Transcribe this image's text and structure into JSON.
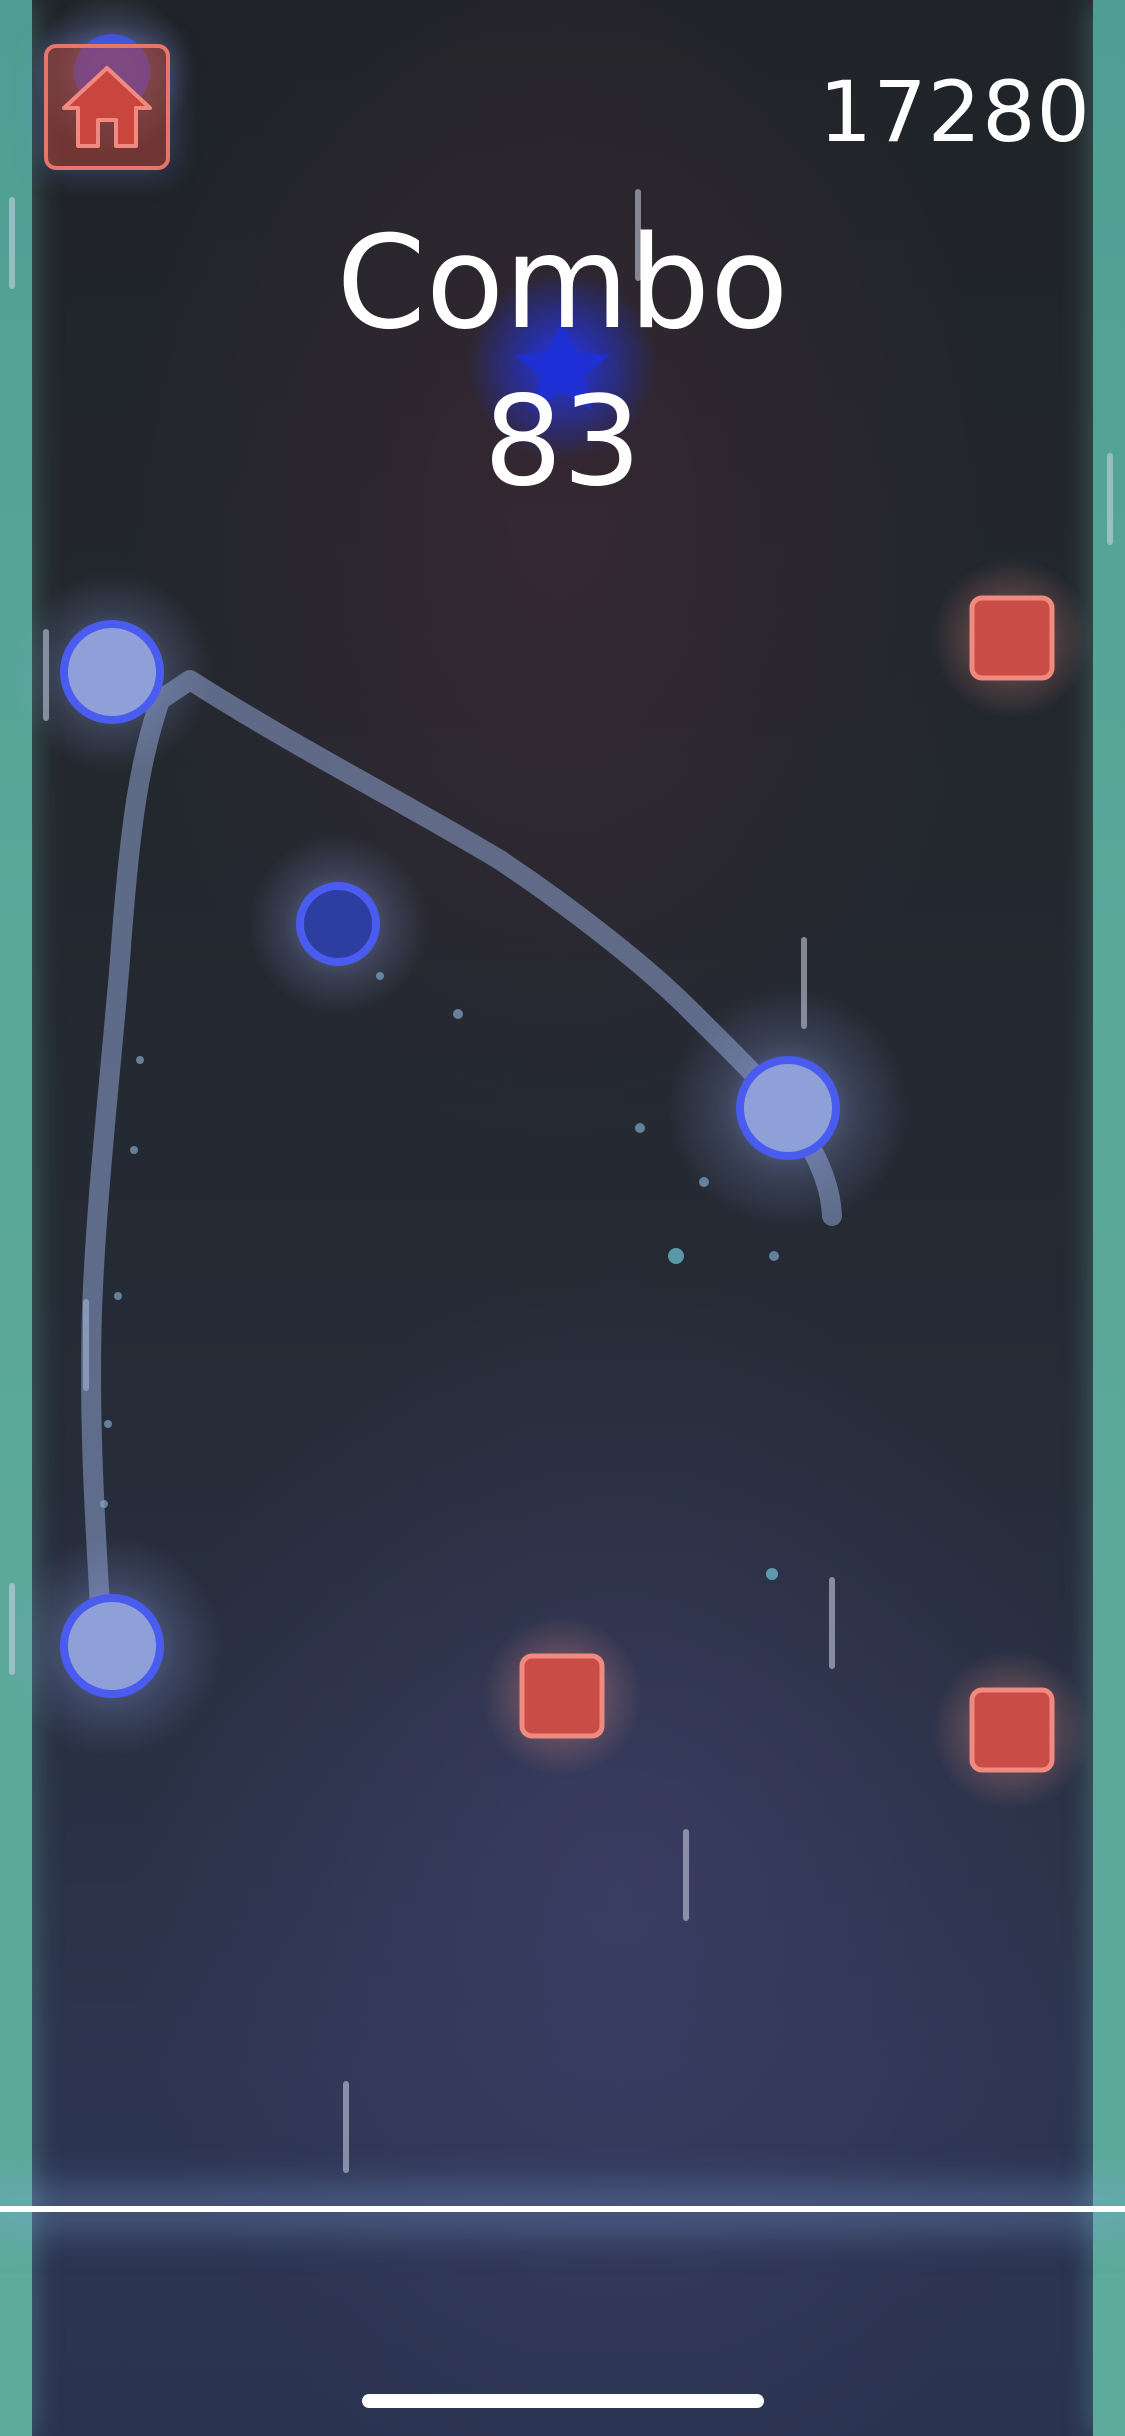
{
  "hud": {
    "home_icon": "house-icon",
    "score": "17280",
    "combo_label": "Combo",
    "combo_count": "83"
  },
  "colors": {
    "rail": "#5aa89a",
    "note_blue": "#4a5cf0",
    "note_red": "#d4534a",
    "trail": "#7f93bf",
    "hit_line": "#ffffff"
  },
  "notes": {
    "circles": 5,
    "squares": 3,
    "star": 1,
    "rain_streaks": 10
  }
}
